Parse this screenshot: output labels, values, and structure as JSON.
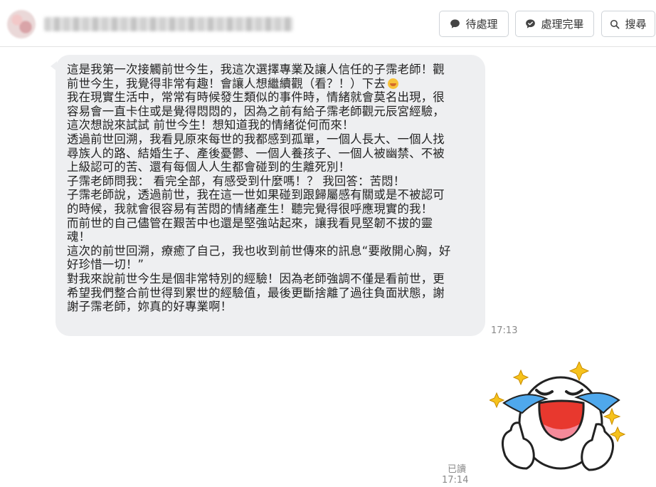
{
  "header": {
    "contact_name": "",
    "buttons": {
      "pending": "待處理",
      "done": "處理完畢",
      "search": "搜尋"
    }
  },
  "message": {
    "lines": [
      "這是我第一次接觸前世今生，我這次選擇專業及讓人信任的子霈老師！觀",
      "前世今生，我覺得非常有趣！會讓人想繼續觀（看？！）下去",
      "我在現實生活中，常常有時候發生類似的事件時，情緒就會莫名出現，很",
      "容易會一直卡住或是覺得悶悶的，因為之前有給子霈老師觀元辰宮經驗，",
      "這次想說來試試 前世今生！想知道我的情緒從何而來！",
      "透過前世回溯，我看見原來每世的我都感到孤單，一個人長大、一個人找",
      "尋族人的路、結婚生子、產後憂鬱、一個人養孩子、一個人被幽禁、不被",
      "上級認可的苦、還有每個人人生都會碰到的生離死別！",
      "子霈老師問我： 看完全部，有感受到什麼嗎！？ 我回答：苦悶！",
      "子霈老師說，透過前世，我在這一世如果碰到跟歸屬感有關或是不被認可",
      "的時候，我就會很容易有苦悶的情緒產生！聽完覺得很呼應現實的我！",
      "而前世的自己儘管在艱苦中也還是堅強站起來，讓我看見堅韌不拔的靈",
      "魂！",
      "這次的前世回溯，療癒了自己，我也收到前世傳來的訊息“要敞開心胸，好",
      "好珍惜一切！”",
      "對我來說前世今生是個非常特別的經驗！因為老師強調不僅是看前世，更",
      "希望我們整合前世得到累世的經驗值，最後更斷捨離了過往負面狀態，謝",
      "謝子霈老師，妳真的好專業啊！"
    ],
    "time": "17:13"
  },
  "reply": {
    "sticker": "crying-laughing-character-sticker",
    "read_status": "已讀",
    "time": "17:14"
  }
}
